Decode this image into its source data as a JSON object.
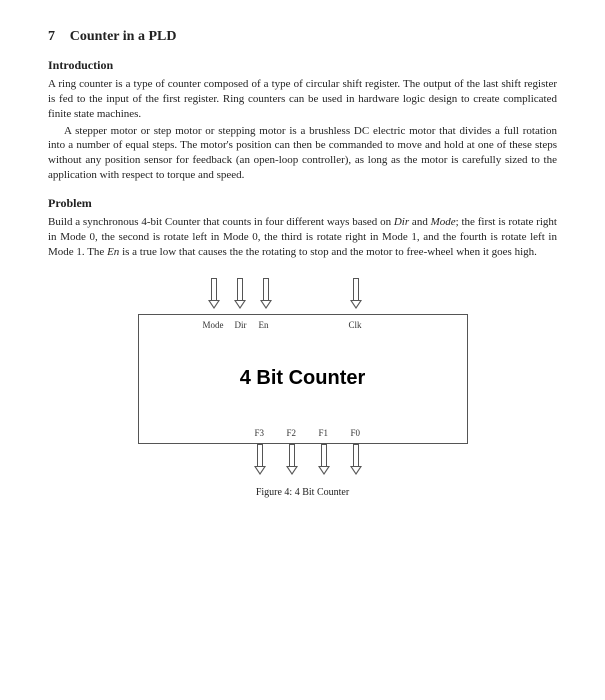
{
  "section": {
    "number": "7",
    "title": "Counter in a PLD"
  },
  "intro": {
    "heading": "Introduction",
    "p1": "A ring counter is a type of counter composed of a type of circular shift register. The output of the last shift register is fed to the input of the first register. Ring counters can be used in hardware logic design to create complicated finite state machines.",
    "p2": "A stepper motor or step motor or stepping motor is a brushless DC electric motor that divides a full rotation into a number of equal steps. The motor's position can then be commanded to move and hold at one of these steps without any position sensor for feedback (an open-loop controller), as long as the motor is carefully sized to the application with respect to torque and speed."
  },
  "problem": {
    "heading": "Problem",
    "p1_a": "Build a synchronous 4-bit Counter that counts in four different ways based on ",
    "dir": "Dir",
    "p1_b": " and ",
    "mode": "Mode",
    "p1_c": "; the first is rotate right in Mode 0, the second is rotate left in Mode 0, the third is rotate right in Mode 1, and the fourth is rotate left in Mode 1. The ",
    "en": "En",
    "p1_d": " is a true low that causes the the rotating to stop and the motor to free-wheel when it goes high."
  },
  "diagram": {
    "inputs": {
      "mode": "Mode",
      "dir": "Dir",
      "en": "En",
      "clk": "Clk"
    },
    "title": "4 Bit Counter",
    "outputs": {
      "f3": "F3",
      "f2": "F2",
      "f1": "F1",
      "f0": "F0"
    },
    "caption": "Figure 4: 4 Bit Counter"
  }
}
